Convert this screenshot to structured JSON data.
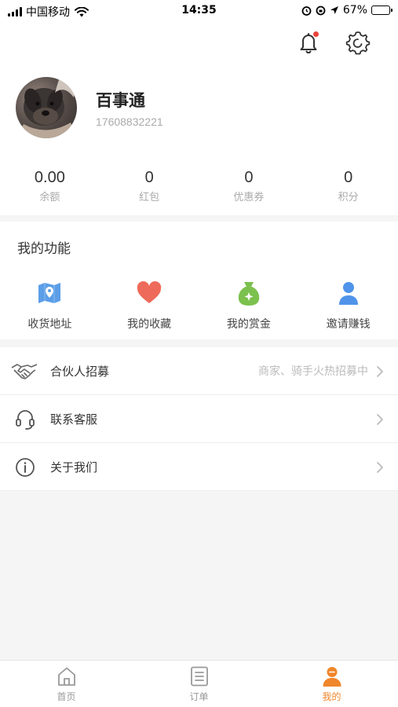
{
  "status_bar": {
    "carrier": "中国移动",
    "time": "14:35",
    "battery": "67%",
    "battery_level": 0.67
  },
  "profile": {
    "name": "百事通",
    "phone": "17608832221"
  },
  "stats": [
    {
      "value": "0.00",
      "label": "余额"
    },
    {
      "value": "0",
      "label": "红包"
    },
    {
      "value": "0",
      "label": "优惠券"
    },
    {
      "value": "0",
      "label": "积分"
    }
  ],
  "features": {
    "title": "我的功能",
    "items": [
      {
        "label": "收货地址",
        "icon": "map-icon",
        "color": "#5b9ee8"
      },
      {
        "label": "我的收藏",
        "icon": "heart-icon",
        "color": "#ee6a5a"
      },
      {
        "label": "我的赏金",
        "icon": "money-bag-icon",
        "color": "#7cc14e"
      },
      {
        "label": "邀请赚钱",
        "icon": "person-icon",
        "color": "#4f94ea"
      }
    ]
  },
  "menu": [
    {
      "label": "合伙人招募",
      "sub": "商家、骑手火热招募中",
      "icon": "handshake-icon"
    },
    {
      "label": "联系客服",
      "sub": "",
      "icon": "headset-icon"
    },
    {
      "label": "关于我们",
      "sub": "",
      "icon": "info-icon"
    }
  ],
  "tabbar": [
    {
      "label": "首页",
      "icon": "home-icon"
    },
    {
      "label": "订单",
      "icon": "order-list-icon"
    },
    {
      "label": "我的",
      "icon": "profile-icon"
    }
  ],
  "colors": {
    "accent": "#f0862b",
    "notification_dot": "#e8443a"
  }
}
